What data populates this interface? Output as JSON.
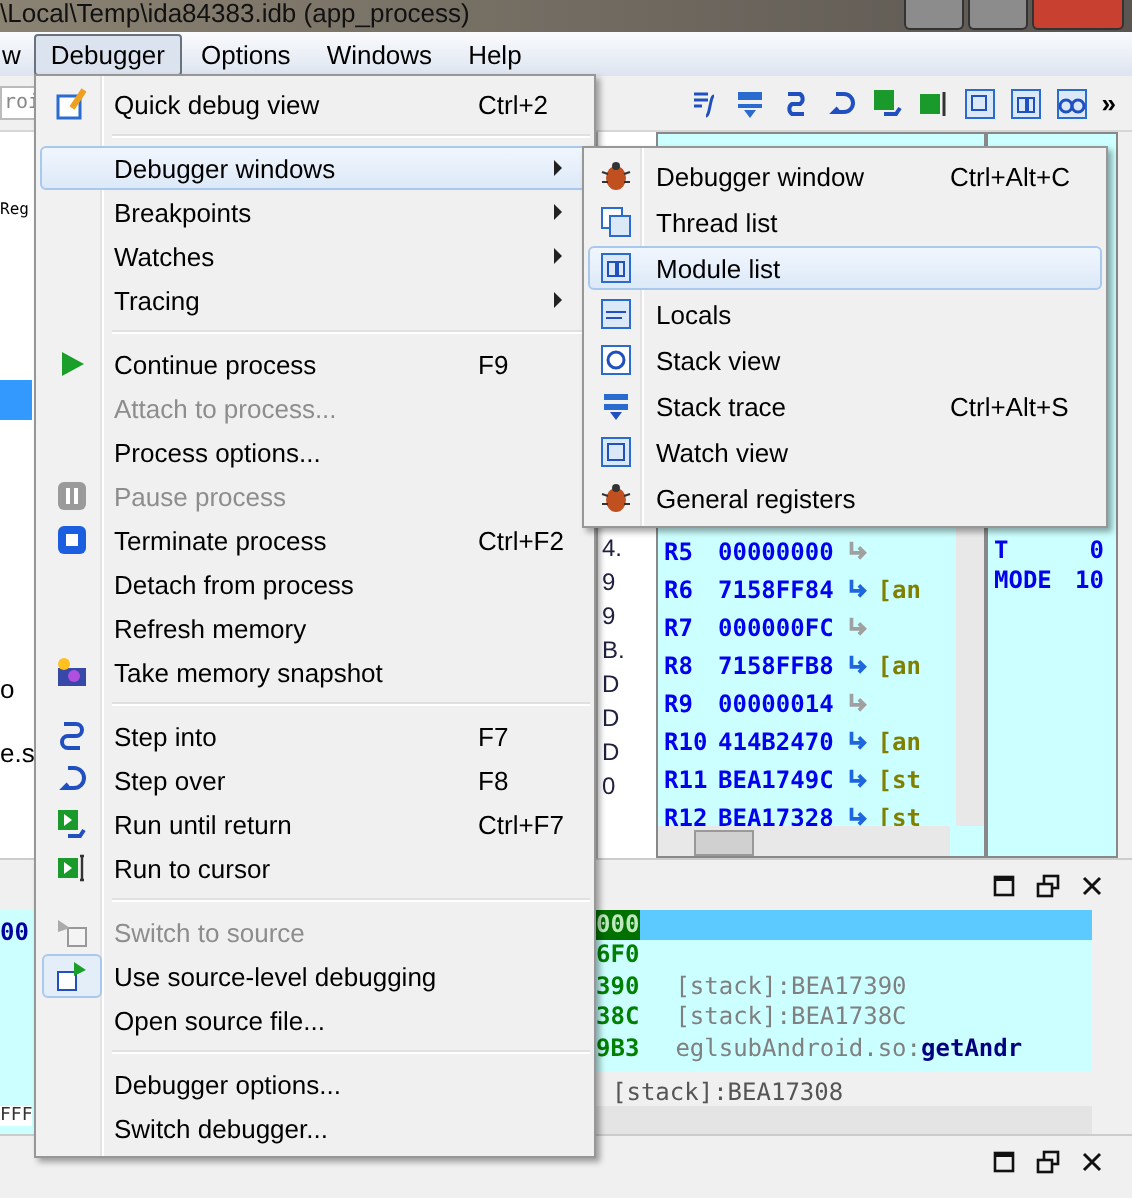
{
  "window": {
    "title": "\\Local\\Temp\\ida84383.idb (app_process)"
  },
  "menubar": [
    {
      "label": "w",
      "selected": false
    },
    {
      "label": "Debugger",
      "selected": true
    },
    {
      "label": "Options",
      "selected": false
    },
    {
      "label": "Windows",
      "selected": false
    },
    {
      "label": "Help",
      "selected": false
    }
  ],
  "toolbar": {
    "overflow": "»"
  },
  "left_strip": {
    "field": "roi",
    "tab": "Reg",
    "texts": [
      "o",
      "e.s"
    ],
    "hex": "00",
    "hex_tail": "FFF"
  },
  "column_3": [
    "4.",
    "9",
    "9",
    "B.",
    "D",
    "D",
    "D",
    "0"
  ],
  "menu": {
    "groups": [
      [
        {
          "label": "Quick debug view",
          "shortcut": "Ctrl+2",
          "submenu": false,
          "disabled": false,
          "selected": false,
          "checked": false
        }
      ],
      [
        {
          "label": "Debugger windows",
          "submenu": true,
          "disabled": false,
          "selected": true,
          "checked": false
        },
        {
          "label": "Breakpoints",
          "submenu": true,
          "disabled": false,
          "selected": false,
          "checked": false
        },
        {
          "label": "Watches",
          "submenu": true,
          "disabled": false,
          "selected": false,
          "checked": false
        },
        {
          "label": "Tracing",
          "submenu": true,
          "disabled": false,
          "selected": false,
          "checked": false
        }
      ],
      [
        {
          "label": "Continue process",
          "shortcut": "F9",
          "submenu": false,
          "disabled": false,
          "selected": false,
          "checked": false
        },
        {
          "label": "Attach to process...",
          "submenu": false,
          "disabled": true,
          "selected": false,
          "checked": false
        },
        {
          "label": "Process options...",
          "submenu": false,
          "disabled": false,
          "selected": false,
          "checked": false
        },
        {
          "label": "Pause process",
          "submenu": false,
          "disabled": true,
          "selected": false,
          "checked": false
        },
        {
          "label": "Terminate process",
          "shortcut": "Ctrl+F2",
          "submenu": false,
          "disabled": false,
          "selected": false,
          "checked": false
        },
        {
          "label": "Detach from process",
          "submenu": false,
          "disabled": false,
          "selected": false,
          "checked": false
        },
        {
          "label": "Refresh memory",
          "submenu": false,
          "disabled": false,
          "selected": false,
          "checked": false
        },
        {
          "label": "Take memory snapshot",
          "submenu": false,
          "disabled": false,
          "selected": false,
          "checked": false
        }
      ],
      [
        {
          "label": "Step into",
          "shortcut": "F7",
          "submenu": false,
          "disabled": false,
          "selected": false,
          "checked": false
        },
        {
          "label": "Step over",
          "shortcut": "F8",
          "submenu": false,
          "disabled": false,
          "selected": false,
          "checked": false
        },
        {
          "label": "Run until return",
          "shortcut": "Ctrl+F7",
          "submenu": false,
          "disabled": false,
          "selected": false,
          "checked": false
        },
        {
          "label": "Run to cursor",
          "submenu": false,
          "disabled": false,
          "selected": false,
          "checked": false
        }
      ],
      [
        {
          "label": "Switch to source",
          "submenu": false,
          "disabled": true,
          "selected": false,
          "checked": false
        },
        {
          "label": "Use source-level debugging",
          "submenu": false,
          "disabled": false,
          "selected": false,
          "checked": true
        },
        {
          "label": "Open source file...",
          "submenu": false,
          "disabled": false,
          "selected": false,
          "checked": false
        }
      ],
      [
        {
          "label": "Debugger options...",
          "submenu": false,
          "disabled": false,
          "selected": false,
          "checked": false
        },
        {
          "label": "Switch debugger...",
          "submenu": false,
          "disabled": false,
          "selected": false,
          "checked": false
        }
      ]
    ]
  },
  "submenu": {
    "items": [
      {
        "label": "Debugger window",
        "shortcut": "Ctrl+Alt+C",
        "selected": false
      },
      {
        "label": "Thread list",
        "selected": false
      },
      {
        "label": "Module list",
        "selected": true
      },
      {
        "label": "Locals",
        "selected": false
      },
      {
        "label": "Stack view",
        "selected": false
      },
      {
        "label": "Stack trace",
        "shortcut": "Ctrl+Alt+S",
        "selected": false
      },
      {
        "label": "Watch view",
        "selected": false
      },
      {
        "label": "General registers",
        "selected": false
      }
    ]
  },
  "registers": [
    {
      "name": "R5",
      "value": "00000000",
      "pointer": false
    },
    {
      "name": "R6",
      "value": "7158FF84",
      "pointer": true,
      "ref": "[an"
    },
    {
      "name": "R7",
      "value": "000000FC",
      "pointer": false
    },
    {
      "name": "R8",
      "value": "7158FFB8",
      "pointer": true,
      "ref": "[an"
    },
    {
      "name": "R9",
      "value": "00000014",
      "pointer": false
    },
    {
      "name": "R10",
      "value": "414B2470",
      "pointer": true,
      "ref": "[an"
    },
    {
      "name": "R11",
      "value": "BEA1749C",
      "pointer": true,
      "ref": "[st"
    },
    {
      "name": "R12",
      "value": "BEA17328",
      "pointer": true,
      "ref": "[st"
    }
  ],
  "flags": [
    {
      "name": "T",
      "value": "0"
    },
    {
      "name": "MODE",
      "value": "10"
    }
  ],
  "stack": {
    "rows": [
      {
        "address": "000",
        "selected": true
      },
      {
        "address": "6F0",
        "selected": false
      },
      {
        "address": "390",
        "ref": "[stack]:BEA17390",
        "selected": false
      },
      {
        "address": "38C",
        "ref": "[stack]:BEA1738C",
        "selected": false
      },
      {
        "address": "9B3",
        "ref": "eglsubAndroid.so:",
        "symbol": "getAndr",
        "selected": false
      }
    ],
    "status": "[stack]:BEA17308"
  }
}
